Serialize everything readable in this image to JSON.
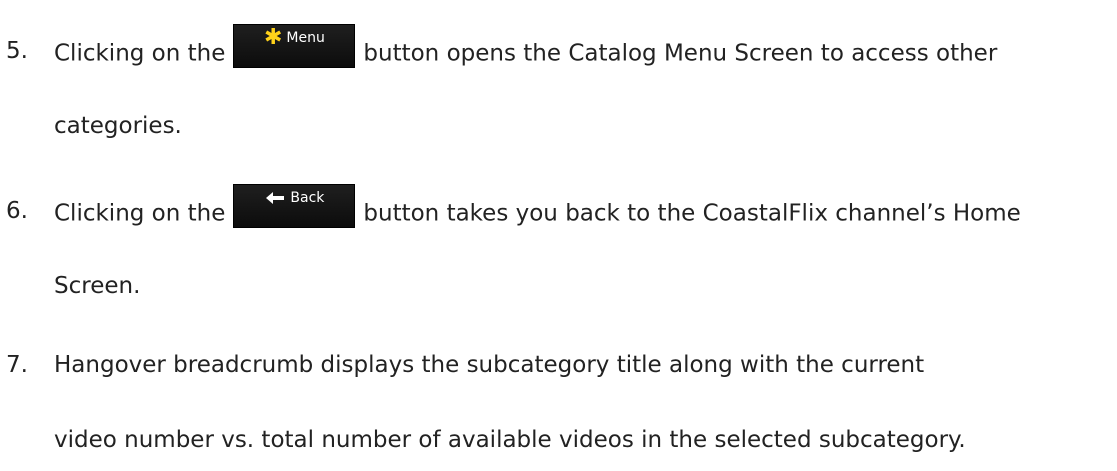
{
  "items": [
    {
      "number": "5.",
      "before_button": "Clicking on the",
      "button": {
        "label": "Menu",
        "icon": "star-icon",
        "icon_color": "#ffd21a"
      },
      "after_button": "button opens the Catalog Menu Screen to access other",
      "continuation": "categories."
    },
    {
      "number": "6.",
      "before_button": "Clicking on the",
      "button": {
        "label": "Back",
        "icon": "arrow-left-icon",
        "icon_color": "#ffffff"
      },
      "after_button": "button takes you back to the CoastalFlix channel’s Home",
      "continuation": "Screen."
    },
    {
      "number": "7.",
      "text": "Hangover breadcrumb displays the subcategory title along with the current",
      "continuation": "video number vs. total number of available videos in the selected subcategory."
    }
  ]
}
